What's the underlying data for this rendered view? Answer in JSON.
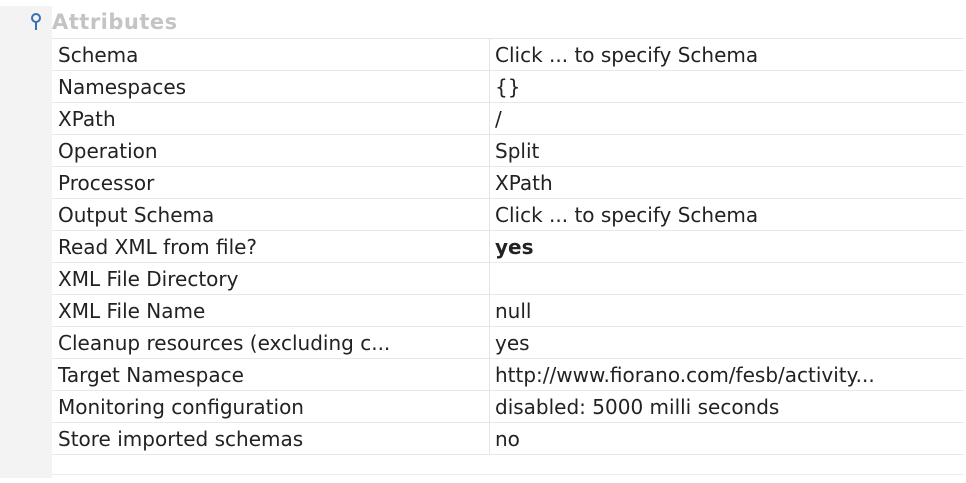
{
  "category": {
    "icon": "pin-icon",
    "label": "Attributes"
  },
  "properties": [
    {
      "name": "Schema",
      "value": "Click ... to specify Schema"
    },
    {
      "name": "Namespaces",
      "value": "{}"
    },
    {
      "name": "XPath",
      "value": "/"
    },
    {
      "name": "Operation",
      "value": "Split"
    },
    {
      "name": "Processor",
      "value": "XPath"
    },
    {
      "name": "Output Schema",
      "value": "Click ... to specify Schema"
    },
    {
      "name": "Read XML from file?",
      "value": "yes"
    },
    {
      "name": "XML File Directory",
      "value": ""
    },
    {
      "name": "XML File Name",
      "value": "null"
    },
    {
      "name": "Cleanup resources (excluding c...",
      "value": "yes"
    },
    {
      "name": "Target Namespace",
      "value": "http://www.fiorano.com/fesb/activity..."
    },
    {
      "name": "Monitoring configuration",
      "value": "disabled: 5000 milli seconds"
    },
    {
      "name": "Store imported schemas",
      "value": "no"
    }
  ],
  "colors": {
    "category_text": "#c4c4c4",
    "icon": "#3a6fb0"
  }
}
